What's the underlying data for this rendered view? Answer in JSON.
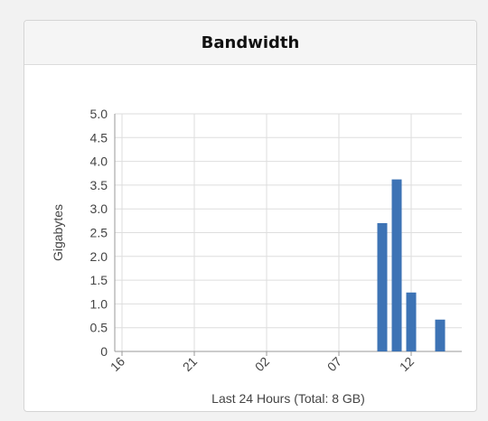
{
  "panel": {
    "title": "Bandwidth"
  },
  "chart_data": {
    "type": "bar",
    "title": "Bandwidth",
    "xlabel": "Last 24 Hours (Total: 8 GB)",
    "ylabel": "Gigabytes",
    "ylim": [
      0,
      5
    ],
    "yticks": [
      "0",
      "0.5",
      "1.0",
      "1.5",
      "2.0",
      "2.5",
      "3.0",
      "3.5",
      "4.0",
      "4.5",
      "5.0"
    ],
    "xlim": [
      15.5,
      15.5
    ],
    "xticks": [
      "16",
      "21",
      "02",
      "07",
      "12"
    ],
    "grid": true,
    "series": [
      {
        "color": "#3d73b5",
        "points": [
          {
            "hour": 10,
            "value": 2.7
          },
          {
            "hour": 11,
            "value": 3.62
          },
          {
            "hour": 12,
            "value": 1.24
          },
          {
            "hour": 14,
            "value": 0.67
          }
        ]
      }
    ]
  }
}
